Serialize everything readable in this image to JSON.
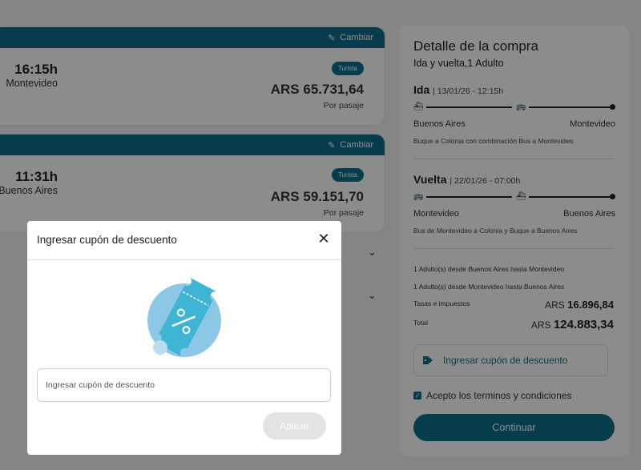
{
  "trips": [
    {
      "change_label": "Cambiar",
      "time": "16:15h",
      "city": "Montevideo",
      "class_badge": "Turista",
      "price": "ARS 65.731,64",
      "per_ticket": "Por pasaje"
    },
    {
      "change_label": "Cambiar",
      "time": "11:31h",
      "city": "Buenos Aires",
      "class_badge": "Turista",
      "price": "ARS 59.151,70",
      "per_ticket": "Por pasaje"
    }
  ],
  "summary": {
    "title": "Detalle de la compra",
    "subtitle": "Ida y vuelta,1 Adulto",
    "outbound": {
      "label": "Ida",
      "date": "13/01/26 - 12:15h",
      "origin": "Buenos Aires",
      "destination": "Montevideo",
      "description": "Buque a Colonia con combinación Bus a Montevideo"
    },
    "return": {
      "label": "Vuelta",
      "date": "22/01/26 - 07:00h",
      "origin": "Montevideo",
      "destination": "Buenos Aires",
      "description": "Bus de Montevideo a Colonia y Buque a Buenos Aires"
    },
    "line_items": [
      "1 Adulto(s) desde Buenos Aires hasta Montevideo",
      "1 Adulto(s) desde Montevideo hasta Buenos Aires"
    ],
    "taxes_label": "Tasas e impuestos",
    "taxes_currency": "ARS",
    "taxes_amount": "16.896,84",
    "total_label": "Total",
    "total_currency": "ARS",
    "total_amount": "124.883,34",
    "coupon_button": "Ingresar cupón de descuento",
    "terms_label": "Acepto los terminos y condiciones",
    "terms_checked": true,
    "continue_button": "Continuar"
  },
  "modal": {
    "title": "Ingresar cupón de descuento",
    "input_placeholder": "Ingresar cupón de descuento",
    "input_value": "",
    "apply_button": "Aplicar",
    "illustration_icon": "discount-ticket-icon"
  },
  "colors": {
    "brand": "#0d6d8c",
    "illustration_circle": "#8cc8e6",
    "illustration_ticket": "#3fb5d5",
    "apply_disabled": "#e3e3e3"
  }
}
